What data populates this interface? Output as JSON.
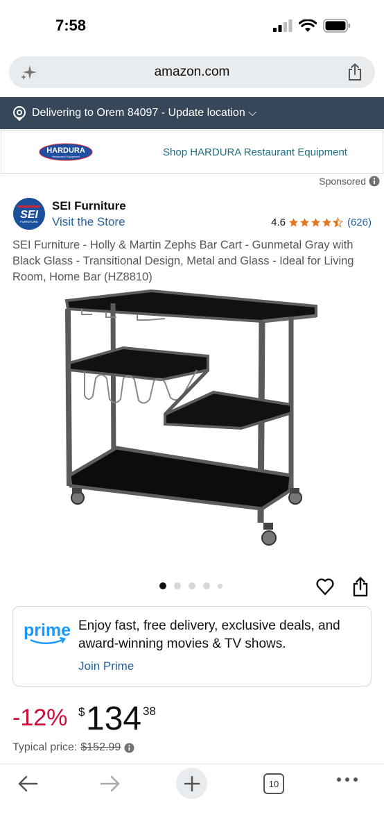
{
  "status_bar": {
    "time": "7:58"
  },
  "browser": {
    "url": "amazon.com"
  },
  "delivery": {
    "text": "Delivering to Orem 84097 - Update location ⌵"
  },
  "banner": {
    "logo_text": "HARDURA",
    "logo_subtext": "Restaurant Equipment",
    "link": "Shop HARDURA Restaurant Equipment"
  },
  "sponsored": {
    "label": "Sponsored"
  },
  "brand": {
    "logo_text": "SEI",
    "logo_subtext": "FURNITURE",
    "name": "SEI Furniture",
    "store_link": "Visit the Store"
  },
  "rating": {
    "value": "4.6",
    "stars": 4.6,
    "count": "(626)"
  },
  "product": {
    "title": "SEI Furniture - Holly & Martin Zephs Bar Cart - Gunmetal Gray with Black Glass - Transitional Design, Metal and Glass - Ideal for Living Room, Home Bar (HZ8810)"
  },
  "gallery": {
    "dot_count": 5,
    "active_index": 0
  },
  "prime": {
    "logo_text": "prime",
    "text": "Enjoy fast, free delivery, exclusive deals, and award-winning movies & TV shows.",
    "join": "Join Prime"
  },
  "price": {
    "discount": "-12%",
    "symbol": "$",
    "whole": "134",
    "fraction": "38",
    "typical_label": "Typical price:",
    "typical_value": "$152.99"
  },
  "toolbar": {
    "tab_count": "10"
  },
  "colors": {
    "nav_bg": "#37475a",
    "link": "#2162a1",
    "star": "#de7921",
    "discount": "#cc0c39",
    "prime_blue": "#1a98ff"
  }
}
